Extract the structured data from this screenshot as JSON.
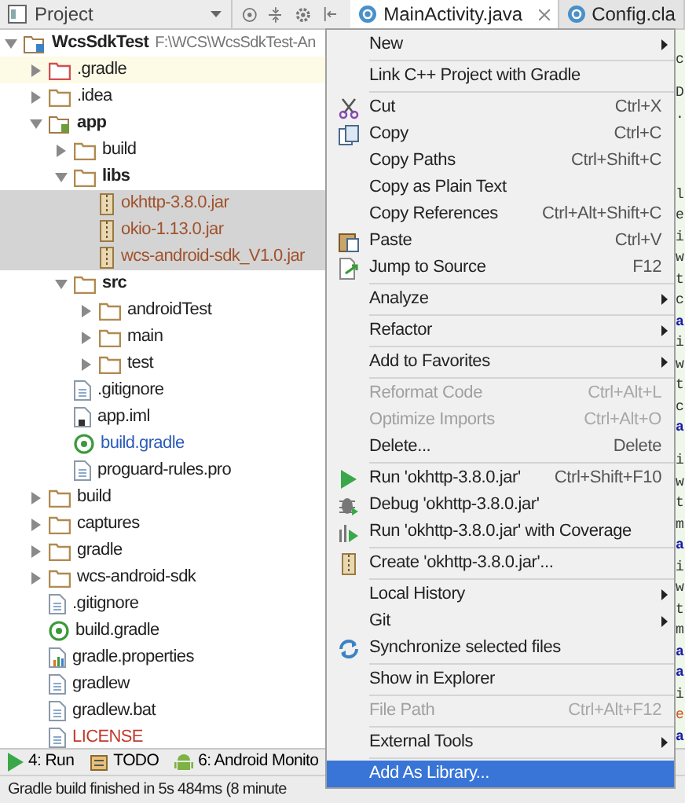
{
  "toolbar": {
    "panel_title": "Project"
  },
  "tabs": [
    {
      "label": "MainActivity.java",
      "selected": true,
      "closable": true
    },
    {
      "label": "Config.cla",
      "selected": false,
      "closable": false
    }
  ],
  "tree": [
    {
      "label": "WcsSdkTest",
      "path": "F:\\WCS\\WcsSdkTest-An",
      "kind": "project",
      "expanded": true,
      "selected": false,
      "children": [
        {
          "label": ".gradle",
          "kind": "folder-excluded",
          "expanded": false,
          "selected": false,
          "highlighted": true
        },
        {
          "label": ".idea",
          "kind": "folder",
          "expanded": false,
          "selected": false
        },
        {
          "label": "app",
          "kind": "module",
          "expanded": true,
          "selected": false,
          "children": [
            {
              "label": "build",
              "kind": "folder",
              "expanded": false,
              "selected": false
            },
            {
              "label": "libs",
              "kind": "folder",
              "expanded": true,
              "selected": false,
              "children": [
                {
                  "label": "okhttp-3.8.0.jar",
                  "kind": "jar",
                  "selected": true
                },
                {
                  "label": "okio-1.13.0.jar",
                  "kind": "jar",
                  "selected": true
                },
                {
                  "label": "wcs-android-sdk_V1.0.jar",
                  "kind": "jar",
                  "selected": true
                }
              ]
            },
            {
              "label": "src",
              "kind": "folder",
              "expanded": true,
              "selected": false,
              "children": [
                {
                  "label": "androidTest",
                  "kind": "folder",
                  "expanded": false,
                  "selected": false
                },
                {
                  "label": "main",
                  "kind": "folder",
                  "expanded": false,
                  "selected": false
                },
                {
                  "label": "test",
                  "kind": "folder",
                  "expanded": false,
                  "selected": false
                }
              ]
            },
            {
              "label": ".gitignore",
              "kind": "file",
              "selected": false
            },
            {
              "label": "app.iml",
              "kind": "iml",
              "selected": false
            },
            {
              "label": "build.gradle",
              "kind": "gradle",
              "selected": false,
              "modified": true
            },
            {
              "label": "proguard-rules.pro",
              "kind": "file",
              "selected": false
            }
          ]
        },
        {
          "label": "build",
          "kind": "folder",
          "expanded": false,
          "selected": false
        },
        {
          "label": "captures",
          "kind": "folder",
          "expanded": false,
          "selected": false
        },
        {
          "label": "gradle",
          "kind": "folder",
          "expanded": false,
          "selected": false
        },
        {
          "label": "wcs-android-sdk",
          "kind": "folder",
          "expanded": false,
          "selected": false
        },
        {
          "label": ".gitignore",
          "kind": "file",
          "selected": false
        },
        {
          "label": "build.gradle",
          "kind": "gradle",
          "selected": false,
          "modified": false
        },
        {
          "label": "gradle.properties",
          "kind": "properties",
          "selected": false
        },
        {
          "label": "gradlew",
          "kind": "file",
          "selected": false
        },
        {
          "label": "gradlew.bat",
          "kind": "file",
          "selected": false
        },
        {
          "label": "LICENSE",
          "kind": "file",
          "selected": false,
          "error": true
        }
      ]
    }
  ],
  "context_menu": [
    {
      "kind": "item",
      "label": "New",
      "submenu": true
    },
    {
      "kind": "separator"
    },
    {
      "kind": "item",
      "label": "Link C++ Project with Gradle"
    },
    {
      "kind": "separator"
    },
    {
      "kind": "scissors",
      "label": "Cut",
      "shortcut": "Ctrl+X"
    },
    {
      "kind": "copy",
      "label": "Copy",
      "shortcut": "Ctrl+C"
    },
    {
      "kind": "item",
      "label": "Copy Paths",
      "shortcut": "Ctrl+Shift+C"
    },
    {
      "kind": "item",
      "label": "Copy as Plain Text"
    },
    {
      "kind": "item",
      "label": "Copy References",
      "shortcut": "Ctrl+Alt+Shift+C"
    },
    {
      "kind": "clipboard",
      "label": "Paste",
      "shortcut": "Ctrl+V"
    },
    {
      "kind": "jump",
      "label": "Jump to Source",
      "shortcut": "F12"
    },
    {
      "kind": "separator"
    },
    {
      "kind": "item",
      "label": "Analyze",
      "submenu": true
    },
    {
      "kind": "separator"
    },
    {
      "kind": "item",
      "label": "Refactor",
      "submenu": true
    },
    {
      "kind": "separator"
    },
    {
      "kind": "item",
      "label": "Add to Favorites",
      "submenu": true
    },
    {
      "kind": "separator"
    },
    {
      "kind": "item",
      "label": "Reformat Code",
      "shortcut": "Ctrl+Alt+L",
      "disabled": true
    },
    {
      "kind": "item",
      "label": "Optimize Imports",
      "shortcut": "Ctrl+Alt+O",
      "disabled": true
    },
    {
      "kind": "item",
      "label": "Delete...",
      "shortcut": "Delete"
    },
    {
      "kind": "separator"
    },
    {
      "kind": "play",
      "label": "Run 'okhttp-3.8.0.jar'",
      "shortcut": "Ctrl+Shift+F10"
    },
    {
      "kind": "bug",
      "label": "Debug 'okhttp-3.8.0.jar'"
    },
    {
      "kind": "coverage",
      "label": "Run 'okhttp-3.8.0.jar' with Coverage"
    },
    {
      "kind": "separator"
    },
    {
      "kind": "jar",
      "label": "Create 'okhttp-3.8.0.jar'..."
    },
    {
      "kind": "separator"
    },
    {
      "kind": "item",
      "label": "Local History",
      "submenu": true
    },
    {
      "kind": "item",
      "label": "Git",
      "submenu": true
    },
    {
      "kind": "sync",
      "label": "Synchronize selected files"
    },
    {
      "kind": "separator"
    },
    {
      "kind": "item",
      "label": "Show in Explorer"
    },
    {
      "kind": "separator"
    },
    {
      "kind": "item",
      "label": "File Path",
      "shortcut": "Ctrl+Alt+F12",
      "disabled": true
    },
    {
      "kind": "separator"
    },
    {
      "kind": "item",
      "label": "External Tools",
      "submenu": true
    },
    {
      "kind": "separator"
    },
    {
      "kind": "item",
      "label": "Add As Library...",
      "selected": true
    }
  ],
  "editor_lines": [
    {
      "kind": "blank"
    },
    {
      "text": "c"
    },
    {
      "kind": "blank"
    },
    {
      "text": "D"
    },
    {
      "text": "."
    },
    {
      "kind": "blank"
    },
    {
      "kind": "blank"
    },
    {
      "kind": "blank"
    },
    {
      "kind": "blank"
    },
    {
      "kind": "blank"
    },
    {
      "text": "l"
    },
    {
      "text": "e"
    },
    {
      "text": "i"
    },
    {
      "text": "w"
    },
    {
      "text": "t"
    },
    {
      "text": "c"
    },
    {
      "text": "a",
      "kind": "keyword"
    },
    {
      "text": "i"
    },
    {
      "text": "w"
    },
    {
      "text": "t"
    },
    {
      "text": "c"
    },
    {
      "text": "a",
      "kind": "keyword"
    },
    {
      "kind": "blank"
    },
    {
      "text": "i"
    },
    {
      "text": "w"
    },
    {
      "text": "t"
    },
    {
      "text": "m"
    },
    {
      "text": "a",
      "kind": "keyword"
    },
    {
      "text": "i"
    },
    {
      "text": "w"
    },
    {
      "text": "t"
    },
    {
      "text": "m"
    },
    {
      "text": "a",
      "kind": "keyword"
    },
    {
      "text": "a",
      "kind": "keyword"
    },
    {
      "text": "i"
    },
    {
      "text": "e",
      "kind": "literal"
    },
    {
      "text": "a",
      "kind": "keyword"
    }
  ],
  "tool_windows": [
    {
      "label": "4: Run",
      "kind": "play"
    },
    {
      "label": "TODO",
      "kind": "todo"
    },
    {
      "label": "6: Android Monito",
      "kind": "android"
    }
  ],
  "status_bar": {
    "text": "Gradle build finished in 5s 484ms (8 minute"
  }
}
